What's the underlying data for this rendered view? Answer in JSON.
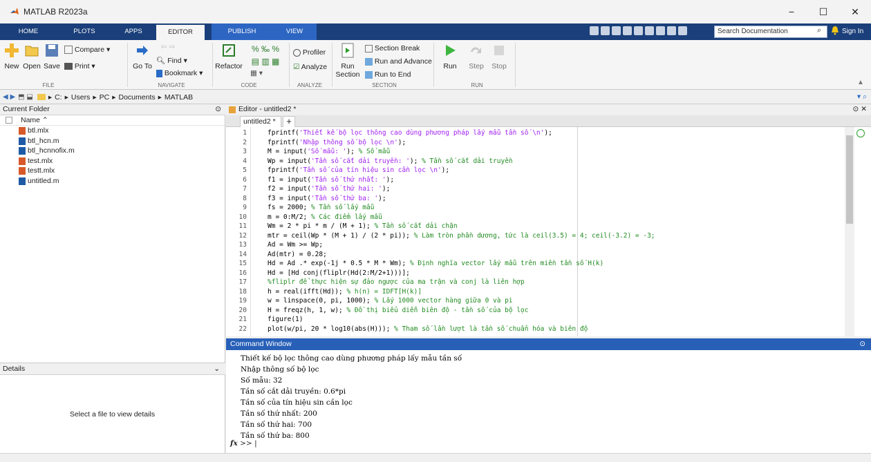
{
  "window": {
    "title": "MATLAB R2023a",
    "minimize": "−",
    "maximize": "☐",
    "close": "✕"
  },
  "ribbon_tabs": [
    "HOME",
    "PLOTS",
    "APPS",
    "EDITOR",
    "PUBLISH",
    "VIEW"
  ],
  "search": {
    "placeholder": "Search Documentation"
  },
  "sign_in": "Sign In",
  "ribbon": {
    "file": {
      "new": "New",
      "open": "Open",
      "save": "Save",
      "compare": "Compare",
      "print": "Print",
      "label": "FILE"
    },
    "navigate": {
      "goto": "Go To",
      "find": "Find",
      "bookmark": "Bookmark",
      "label": "NAVIGATE"
    },
    "code": {
      "refactor": "Refactor",
      "label": "CODE"
    },
    "analyze": {
      "profiler": "Profiler",
      "analyze": "Analyze",
      "label": "ANALYZE"
    },
    "section": {
      "run_section": "Run\nSection",
      "section_break": "Section Break",
      "run_advance": "Run and Advance",
      "run_end": "Run to End",
      "label": "SECTION"
    },
    "run": {
      "run": "Run",
      "step": "Step",
      "stop": "Stop",
      "label": "RUN"
    }
  },
  "address": {
    "drive": "C:",
    "parts": [
      "Users",
      "PC",
      "Documents",
      "MATLAB"
    ]
  },
  "current_folder": {
    "title": "Current Folder",
    "column": "Name",
    "files": [
      "btl.mlx",
      "btl_hcn.m",
      "btl_hcnnofix.m",
      "test.mlx",
      "testt.mlx",
      "untitled.m"
    ]
  },
  "details": {
    "title": "Details",
    "placeholder": "Select a file to view details"
  },
  "editor": {
    "title": "Editor - untitled2 *",
    "tab": "untitled2 *",
    "lines": [
      {
        "n": "1",
        "pre": "fprintf(",
        "str": "'Thiết kế bộ lọc thông cao dùng phương pháp lấy mẫu tần số \\n'",
        "post": ");",
        "cmt": ""
      },
      {
        "n": "2",
        "pre": "fprintf(",
        "str": "'Nhập thông số bộ lọc \\n'",
        "post": ");",
        "cmt": ""
      },
      {
        "n": "3",
        "pre": "M = input(",
        "str": "'Số mẫu: '",
        "post": "); ",
        "cmt": "% Số mẫu"
      },
      {
        "n": "4",
        "pre": "Wp = input(",
        "str": "'Tần số cắt dải truyền: '",
        "post": "); ",
        "cmt": "% Tần số cắt dải truyền"
      },
      {
        "n": "5",
        "pre": "fprintf(",
        "str": "'Tần số của tín hiệu sin cần lọc \\n'",
        "post": ");",
        "cmt": ""
      },
      {
        "n": "6",
        "pre": "f1 = input(",
        "str": "'Tần số thứ nhất: '",
        "post": ");",
        "cmt": ""
      },
      {
        "n": "7",
        "pre": "f2 = input(",
        "str": "'Tần số thứ hai: '",
        "post": ");",
        "cmt": ""
      },
      {
        "n": "8",
        "pre": "f3 = input(",
        "str": "'Tần số thứ ba: '",
        "post": ");",
        "cmt": ""
      },
      {
        "n": "9",
        "pre": "fs = 2000; ",
        "str": "",
        "post": "",
        "cmt": "% Tần số lấy mẫu"
      },
      {
        "n": "10",
        "pre": "m = 0:M/2; ",
        "str": "",
        "post": "",
        "cmt": "% Các điểm lấy mẫu"
      },
      {
        "n": "11",
        "pre": "Wm = 2 * pi * m / (M + 1); ",
        "str": "",
        "post": "",
        "cmt": "% Tần số cắt dải chặn"
      },
      {
        "n": "12",
        "pre": "mtr = ceil(Wp * (M + 1) / (2 * pi)); ",
        "str": "",
        "post": "",
        "cmt": "% Làm tròn phần dương, tức là ceil(3.5) = 4; ceil(-3.2) = -3;"
      },
      {
        "n": "13",
        "pre": "Ad = Wm >= Wp;",
        "str": "",
        "post": "",
        "cmt": ""
      },
      {
        "n": "14",
        "pre": "Ad(mtr) = 0.28;",
        "str": "",
        "post": "",
        "cmt": ""
      },
      {
        "n": "15",
        "pre": "Hd = Ad .* exp(-1j * 0.5 * M * Wm); ",
        "str": "",
        "post": "",
        "cmt": "% Định nghĩa vector lấy mẫu trên miền tần số H(k)"
      },
      {
        "n": "16",
        "pre": "Hd = [Hd conj(fliplr(Hd(2:M/2+1)))];",
        "str": "",
        "post": "",
        "cmt": ""
      },
      {
        "n": "17",
        "pre": "",
        "str": "",
        "post": "",
        "cmt": "%fliplr để thực hiện sự đảo ngược của ma trận và conj là liên hợp"
      },
      {
        "n": "18",
        "pre": "h = real(ifft(Hd)); ",
        "str": "",
        "post": "",
        "cmt": "% h(n) = IDFT[H(k)]"
      },
      {
        "n": "19",
        "pre": "w = linspace(0, pi, 1000); ",
        "str": "",
        "post": "",
        "cmt": "% Lấy 1000 vector hàng giữa 0 và pi"
      },
      {
        "n": "20",
        "pre": "H = freqz(h, 1, w); ",
        "str": "",
        "post": "",
        "cmt": "% Đồ thị biểu diễn biên độ - tần số của bộ lọc"
      },
      {
        "n": "21",
        "pre": "figure(1)",
        "str": "",
        "post": "",
        "cmt": ""
      },
      {
        "n": "22",
        "pre": "plot(w/pi, 20 * log10(abs(H))); ",
        "str": "",
        "post": "",
        "cmt": "% Tham số lần lượt là tần số chuẩn hóa và biên độ"
      }
    ]
  },
  "command_window": {
    "title": "Command Window",
    "lines": [
      "Thiết kế bộ lọc thông cao dùng phương pháp lấy mẫu tần số",
      "Nhập thông số bộ lọc",
      "Số mẫu: 32",
      "Tần số cắt dải truyền: 0.6*pi",
      "Tần số của tín hiệu sin cần lọc",
      "Tần số thứ nhất: 200",
      "Tần số thứ hai: 700",
      "Tần số thứ ba: 800"
    ],
    "fx": "fx",
    "prompt": ">>"
  },
  "colors": {
    "tabbar": "#1a3f7a",
    "active_blue": "#2860b8",
    "string": "#a020f0",
    "comment": "#228b22"
  }
}
